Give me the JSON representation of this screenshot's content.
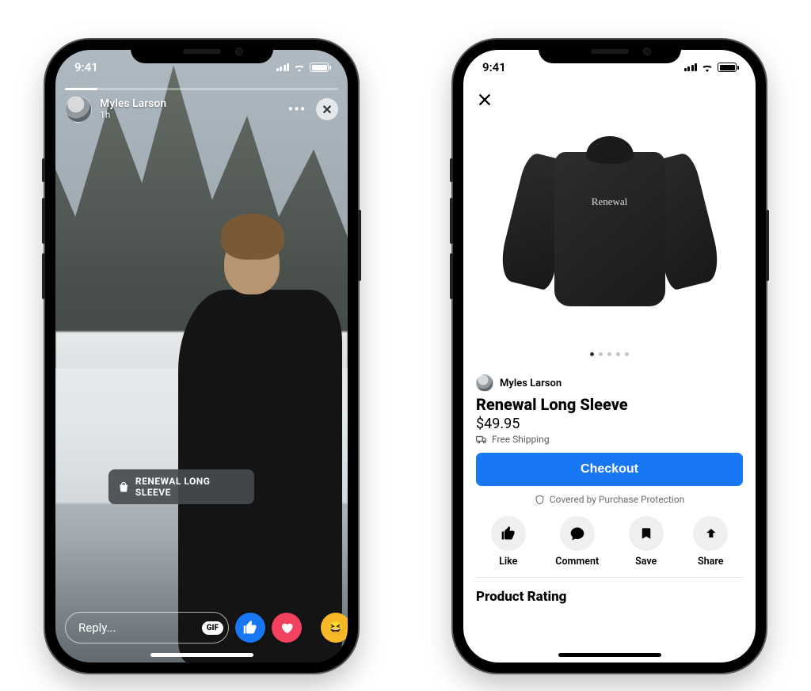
{
  "status": {
    "time": "9:41",
    "wifi_icon": "wifi",
    "battery_icon": "battery-full"
  },
  "story": {
    "user_name": "Myles Larson",
    "time_ago": "1h",
    "more_icon": "more-icon",
    "close_icon": "close-icon",
    "product_tag": {
      "icon": "bag-icon",
      "label": "RENEWAL LONG SLEEVE"
    },
    "reply_placeholder": "Reply...",
    "gif_label": "GIF",
    "reactions": {
      "like": "like-icon",
      "love": "love-icon",
      "laugh": "laugh-icon"
    }
  },
  "product": {
    "close_icon": "close-icon",
    "image_label": "Renewal",
    "pager": {
      "count": 5,
      "active_index": 0
    },
    "seller_name": "Myles Larson",
    "title": "Renewal Long Sleeve",
    "price": "$49.95",
    "shipping_text": "Free Shipping",
    "checkout_label": "Checkout",
    "protection_text": "Covered by Purchase Protection",
    "actions": {
      "like": "Like",
      "comment": "Comment",
      "save": "Save",
      "share": "Share"
    },
    "rating_heading": "Product Rating"
  },
  "colors": {
    "primary": "#1877F2",
    "love": "#F3425F",
    "laugh": "#F7B928"
  }
}
